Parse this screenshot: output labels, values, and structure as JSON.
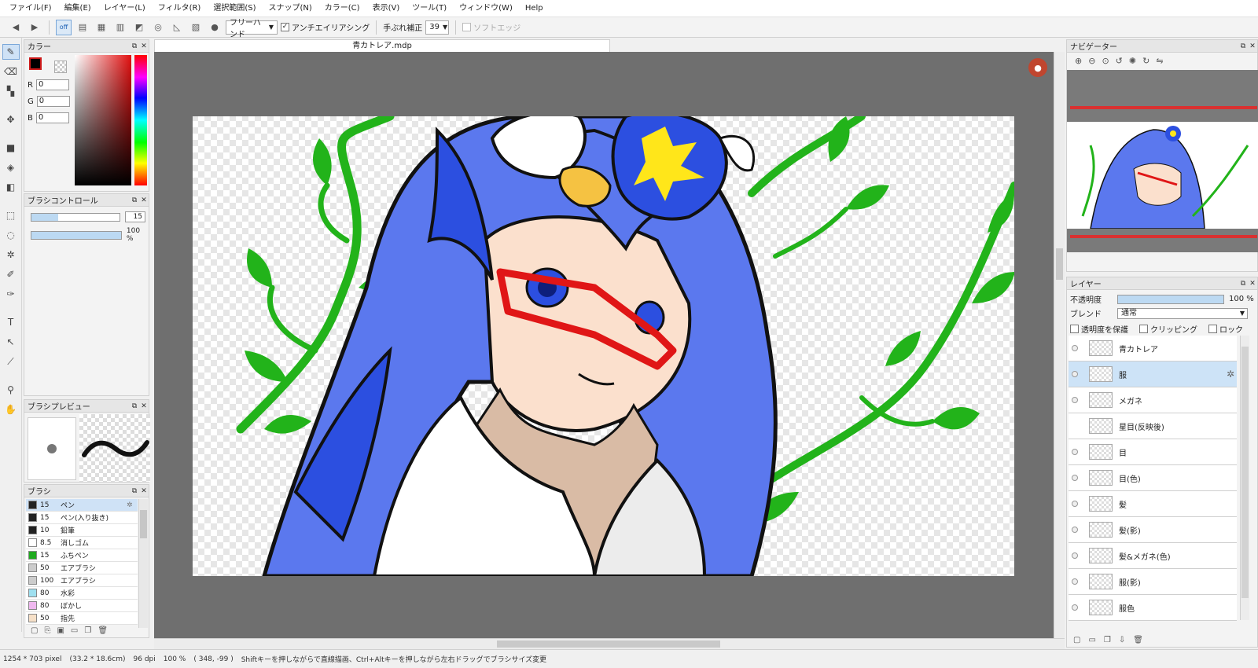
{
  "menu": [
    "ファイル(F)",
    "編集(E)",
    "レイヤー(L)",
    "フィルタ(R)",
    "選択範囲(S)",
    "スナップ(N)",
    "カラー(C)",
    "表示(V)",
    "ツール(T)",
    "ウィンドウ(W)",
    "Help"
  ],
  "toolbar": {
    "snap_off_label": "off",
    "brush_mode": "フリーハンド",
    "antialias_label": "アンチエイリアシング",
    "stabilizer_label": "手ぶれ補正",
    "stabilizer_value": "39",
    "soft_edge_label": "ソフトエッジ"
  },
  "color_panel": {
    "title": "カラー",
    "r_label": "R",
    "r_value": "0",
    "g_label": "G",
    "g_value": "0",
    "b_label": "B",
    "b_value": "0"
  },
  "brush_control": {
    "title": "ブラシコントロール",
    "size_value": "15",
    "size_fraction": 0.3,
    "opacity_value": "100 %",
    "opacity_fraction": 1.0
  },
  "brush_preview": {
    "title": "ブラシプレビュー"
  },
  "brush_panel": {
    "title": "ブラシ",
    "items": [
      {
        "size": "15",
        "name": "ペン",
        "color": "#222222"
      },
      {
        "size": "15",
        "name": "ペン(入り抜き)",
        "color": "#222222"
      },
      {
        "size": "10",
        "name": "鉛筆",
        "color": "#222222"
      },
      {
        "size": "8.5",
        "name": "消しゴム",
        "color": "#ffffff"
      },
      {
        "size": "15",
        "name": "ふちペン",
        "color": "#1faa1f"
      },
      {
        "size": "50",
        "name": "エアブラシ",
        "color": "#cccccc"
      },
      {
        "size": "100",
        "name": "エアブラシ",
        "color": "#cccccc"
      },
      {
        "size": "80",
        "name": "水彩",
        "color": "#9fe0f0"
      },
      {
        "size": "80",
        "name": "ぼかし",
        "color": "#f0b8f0"
      },
      {
        "size": "50",
        "name": "指先",
        "color": "#f6e0c8"
      }
    ]
  },
  "document": {
    "tab_title": "青カトレア.mdp"
  },
  "navigator": {
    "title": "ナビゲーター"
  },
  "layers_panel": {
    "title": "レイヤー",
    "opacity_label": "不透明度",
    "opacity_value": "100 %",
    "opacity_fraction": 1.0,
    "blend_label": "ブレンド",
    "blend_value": "通常",
    "protect_alpha_label": "透明度を保護",
    "clipping_label": "クリッピング",
    "lock_label": "ロック",
    "items": [
      {
        "name": "青カトレア",
        "selected": false,
        "visible": true
      },
      {
        "name": "服",
        "selected": true,
        "visible": true
      },
      {
        "name": "メガネ",
        "selected": false,
        "visible": true
      },
      {
        "name": "星目(反映後)",
        "selected": false,
        "visible": false
      },
      {
        "name": "目",
        "selected": false,
        "visible": true
      },
      {
        "name": "目(色)",
        "selected": false,
        "visible": true
      },
      {
        "name": "髪",
        "selected": false,
        "visible": true
      },
      {
        "name": "髪(影)",
        "selected": false,
        "visible": true
      },
      {
        "name": "髪&メガネ(色)",
        "selected": false,
        "visible": true
      },
      {
        "name": "服(影)",
        "selected": false,
        "visible": true
      },
      {
        "name": "服色",
        "selected": false,
        "visible": true
      }
    ]
  },
  "status": {
    "size": "1254 * 703 pixel",
    "physical": "(33.2 * 18.6cm)",
    "dpi": "96 dpi",
    "zoom": "100 %",
    "coords": "( 348, -99 )",
    "hint": "Shiftキーを押しながらで直線描画、Ctrl+Altキーを押しながら左右ドラッグでブラシサイズ変更"
  },
  "colors": {
    "hair": "#5b78ee",
    "hair_shadow": "#2c4fe0",
    "leaf": "#22b31a",
    "skin": "#fbe0cd",
    "glasses": "#e01616",
    "flower_yellow": "#ffe61a"
  }
}
